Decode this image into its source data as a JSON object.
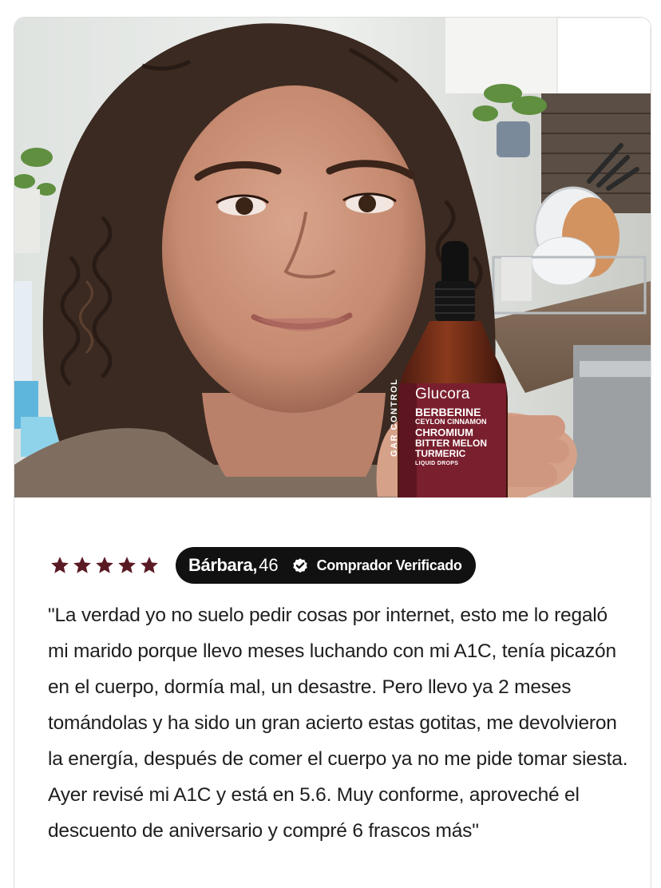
{
  "review": {
    "rating": 5,
    "rating_max": 5,
    "star_color": "#5a1a24",
    "reviewer_name": "Bárbara,",
    "reviewer_age": "46",
    "verified_label": "Comprador Verificado",
    "badge_color": "#111111",
    "text": "\"La verdad yo no suelo pedir cosas por internet, esto me lo regaló mi marido porque llevo meses luchando con mi A1C, tenía picazón en el cuerpo, dormía mal, un desastre. Pero llevo ya 2 meses tomándolas y ha sido un gran acierto estas gotitas, me devolvieron la energía, después de comer el cuerpo ya no me pide tomar siesta. Ayer revisé mi A1C y está en 5.6. Muy conforme, aproveché el descuento de aniversario y compré 6 frascos más\""
  },
  "photo": {
    "label": {
      "brand": "Glucora",
      "lines": [
        "BERBERINE",
        "CEYLON CINNAMON",
        "CHROMIUM",
        "BITTER MELON",
        "TURMERIC"
      ],
      "form": "LIQUID DROPS",
      "side_text": "GAR CONTROL"
    }
  }
}
